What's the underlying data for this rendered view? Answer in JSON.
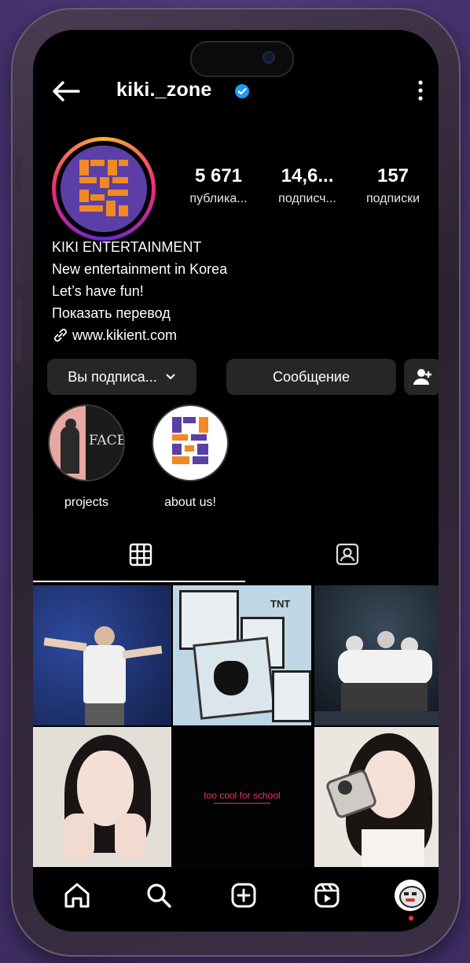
{
  "profile": {
    "username": "kiki._zone",
    "stats": [
      {
        "value": "5 671",
        "label": "публика..."
      },
      {
        "value": "14,6...",
        "label": "подписч..."
      },
      {
        "value": "157",
        "label": "подписки"
      }
    ],
    "bio": {
      "name": "KIKI ENTERTAINMENT",
      "line1": "New entertainment in Korea",
      "line2": "Let’s have fun!",
      "translate": "Показать перевод",
      "website": "www.kikient.com"
    }
  },
  "buttons": {
    "following": "Вы подписа...",
    "message": "Сообщение"
  },
  "highlights": [
    {
      "label": "projects",
      "cover_text": "FACE"
    },
    {
      "label": "about us!"
    }
  ],
  "tabs": [
    {
      "icon": "grid-icon",
      "active": true
    },
    {
      "icon": "tagged-icon",
      "active": false
    }
  ],
  "posts": {
    "center_text": "too cool for school",
    "sticker_text": "TNT"
  },
  "nav": [
    "home-icon",
    "search-icon",
    "create-icon",
    "reels-icon",
    "profile-avatar-icon"
  ],
  "colors": {
    "brand_purple": "#5b3ea6",
    "brand_orange": "#f08a22",
    "verified_blue": "#1d9bf0",
    "button_bg": "#262626"
  }
}
